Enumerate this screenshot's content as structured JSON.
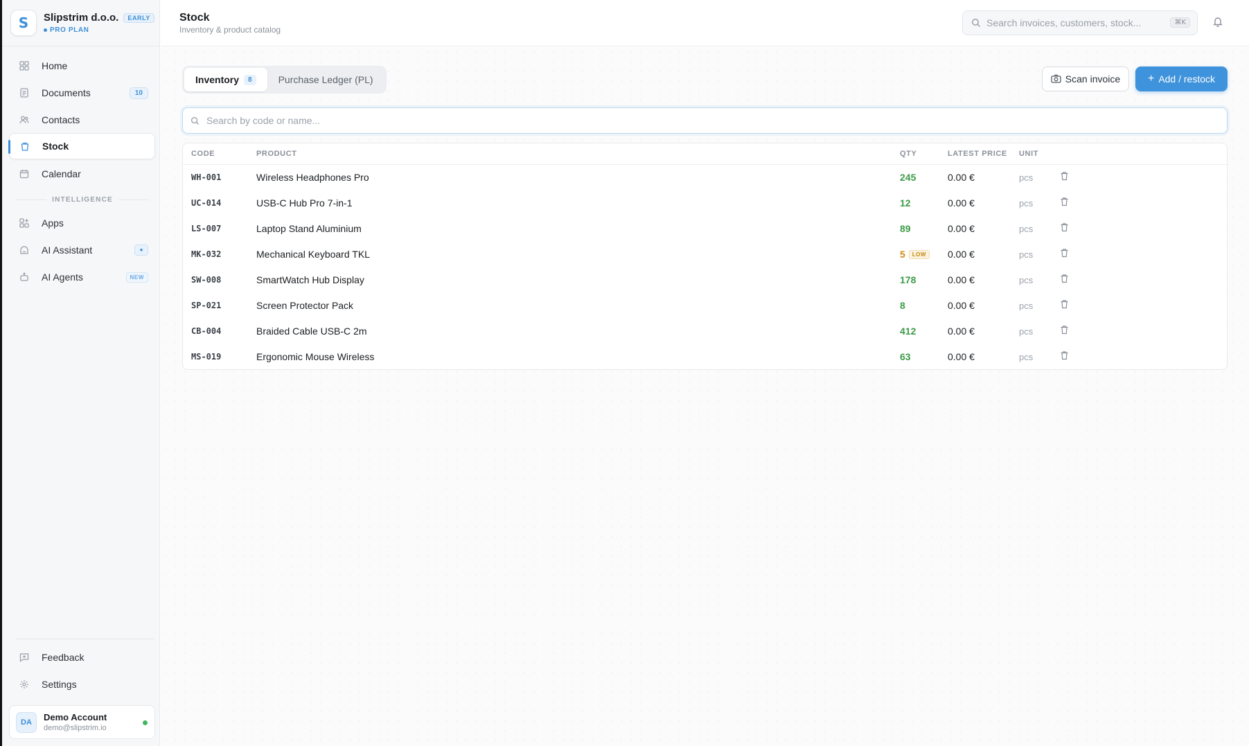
{
  "brand": {
    "logo_letter": "S",
    "name": "Slipstrim d.o.o.",
    "badge": "EARLY",
    "plan": "PRO PLAN"
  },
  "sidebar": {
    "items": [
      {
        "label": "Home",
        "icon": "grid-icon"
      },
      {
        "label": "Documents",
        "icon": "document-icon",
        "count": "10"
      },
      {
        "label": "Contacts",
        "icon": "users-icon"
      },
      {
        "label": "Stock",
        "icon": "box-icon",
        "active": true
      },
      {
        "label": "Calendar",
        "icon": "calendar-icon"
      }
    ],
    "section_label": "INTELLIGENCE",
    "intel_items": [
      {
        "label": "Apps",
        "icon": "apps-icon"
      },
      {
        "label": "AI Assistant",
        "icon": "robot-icon",
        "badge": "✦"
      },
      {
        "label": "AI Agents",
        "icon": "agents-icon",
        "badge": "NEW"
      }
    ],
    "bottom_items": [
      {
        "label": "Feedback",
        "icon": "feedback-icon"
      },
      {
        "label": "Settings",
        "icon": "gear-icon"
      }
    ],
    "account": {
      "initials": "DA",
      "name": "Demo Account",
      "email": "demo@slipstrim.io"
    }
  },
  "header": {
    "title": "Stock",
    "subtitle": "Inventory & product catalog",
    "search_placeholder": "Search invoices, customers, stock...",
    "search_shortcut": "⌘K"
  },
  "tabs": [
    {
      "label": "Inventory",
      "count": "8",
      "active": true
    },
    {
      "label": "Purchase Ledger (PL)"
    }
  ],
  "actions": {
    "scan": "Scan invoice",
    "add": "Add / restock"
  },
  "table_search_placeholder": "Search by code or name...",
  "table": {
    "columns": [
      "CODE",
      "PRODUCT",
      "QTY",
      "LATEST PRICE",
      "UNIT"
    ],
    "rows": [
      {
        "code": "WH-001",
        "product": "Wireless Headphones Pro",
        "qty": "245",
        "price": "0.00 €",
        "unit": "pcs"
      },
      {
        "code": "UC-014",
        "product": "USB-C Hub Pro 7-in-1",
        "qty": "12",
        "price": "0.00 €",
        "unit": "pcs"
      },
      {
        "code": "LS-007",
        "product": "Laptop Stand Aluminium",
        "qty": "89",
        "price": "0.00 €",
        "unit": "pcs"
      },
      {
        "code": "MK-032",
        "product": "Mechanical Keyboard TKL",
        "qty": "5",
        "low": "LOW",
        "price": "0.00 €",
        "unit": "pcs"
      },
      {
        "code": "SW-008",
        "product": "SmartWatch Hub Display",
        "qty": "178",
        "price": "0.00 €",
        "unit": "pcs"
      },
      {
        "code": "SP-021",
        "product": "Screen Protector Pack",
        "qty": "8",
        "price": "0.00 €",
        "unit": "pcs"
      },
      {
        "code": "CB-004",
        "product": "Braided Cable USB-C 2m",
        "qty": "412",
        "price": "0.00 €",
        "unit": "pcs"
      },
      {
        "code": "MS-019",
        "product": "Ergonomic Mouse Wireless",
        "qty": "63",
        "price": "0.00 €",
        "unit": "pcs"
      }
    ]
  },
  "colors": {
    "accent": "#3f93dc",
    "qty_ok": "#3d9b49",
    "qty_low": "#d08a16",
    "online": "#3fb860"
  }
}
